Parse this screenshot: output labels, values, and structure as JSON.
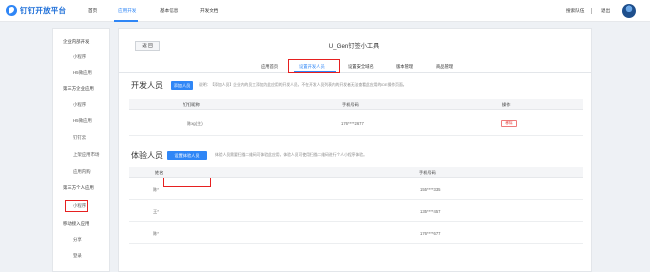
{
  "brand": {
    "name": "钉钉开放平台"
  },
  "nav": {
    "items": [
      "首页",
      "应用开发",
      "基本信息",
      "开发文档"
    ],
    "active": "应用开发"
  },
  "topright": {
    "org": "搜索队伍",
    "separator": "|",
    "logout": "退出"
  },
  "sidebar": {
    "groups": [
      {
        "label": "企业内部开发",
        "items": [
          "小程序",
          "H5微应用"
        ]
      },
      {
        "label": "第三方企业应用",
        "items": [
          "小程序",
          "H5微应用",
          "钉钉云",
          "上架应用市场",
          "应用内购"
        ]
      },
      {
        "label": "第三方个人应用",
        "items": [
          "小程序"
        ]
      },
      {
        "label": "移动接入应用",
        "items": [
          "分享",
          "登录"
        ]
      }
    ],
    "active_item": "小程序"
  },
  "main": {
    "back_label": "返 回",
    "title": "U_Gen钉签小工具",
    "tabs": [
      "应用首页",
      "设置开发人员",
      "设置安全域名",
      "版本管理",
      "商品管理"
    ],
    "active_tab": "设置开发人员",
    "dev": {
      "title": "开发人员",
      "add_button": "添加人员",
      "note": "说明：【添加人员】企业内的员工添加为此应用的开发人员，不在开发人员列表内的开发者无法查看此应用的IDE操作页面。",
      "columns": [
        "钉钉昵称",
        "手机号码",
        "操作"
      ],
      "rows": [
        {
          "name": "陈xg(主)",
          "phone": "176****2677",
          "action": "移除"
        }
      ]
    },
    "exp": {
      "title": "体验人员",
      "add_button": "设置体验人员",
      "note": "体验人员需要扫描二维码可体验此应用，体验人员可使用扫描二维码进行个人小程序体验。",
      "columns": [
        "姓名",
        "手机号码"
      ],
      "rows": [
        {
          "name": "陈*",
          "phone": "155****335"
        },
        {
          "name": "王*",
          "phone": "135****457"
        },
        {
          "name": "陈*",
          "phone": "176****677"
        }
      ]
    }
  },
  "colors": {
    "accent": "#2f86f6",
    "highlight_box": "#e62020",
    "danger": "#e53935"
  }
}
